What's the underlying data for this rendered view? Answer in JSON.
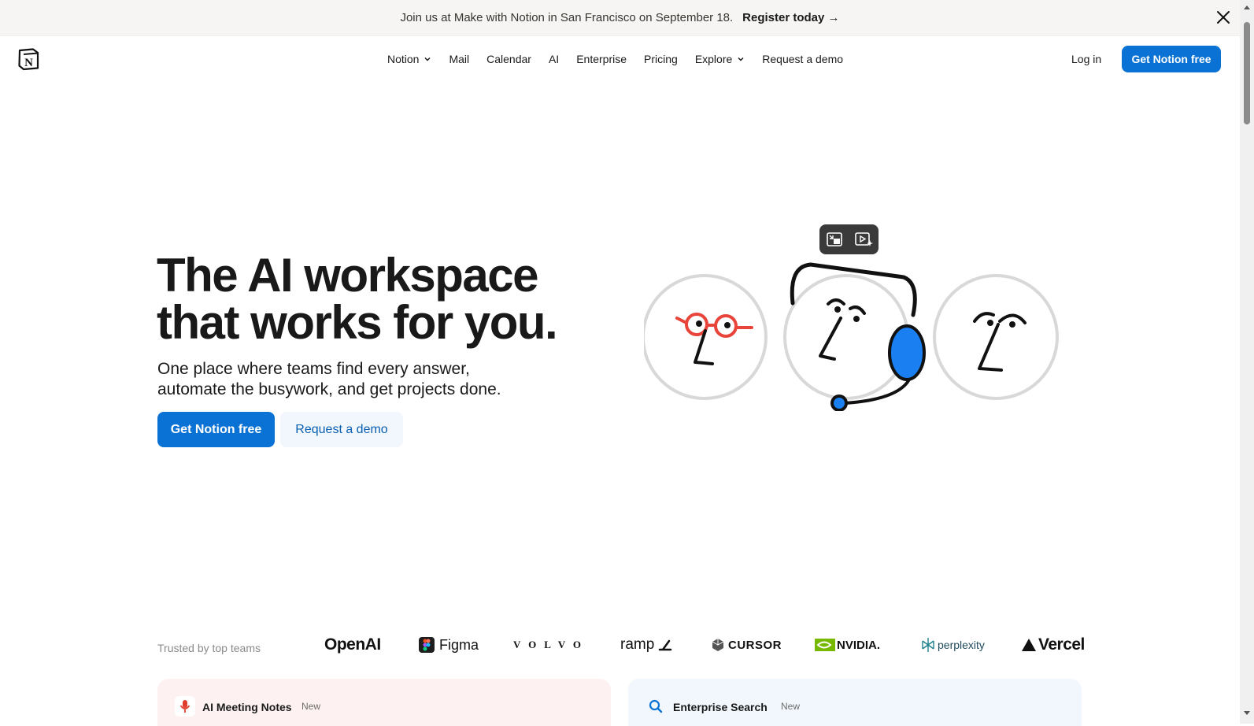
{
  "banner": {
    "message": "Join us at Make with Notion in San Francisco on September 18.",
    "link": "Register today →"
  },
  "nav": {
    "items": [
      {
        "label": "Notion",
        "has_dropdown": true
      },
      {
        "label": "Mail",
        "has_dropdown": false
      },
      {
        "label": "Calendar",
        "has_dropdown": false
      },
      {
        "label": "AI",
        "has_dropdown": false
      },
      {
        "label": "Enterprise",
        "has_dropdown": false
      },
      {
        "label": "Pricing",
        "has_dropdown": false
      },
      {
        "label": "Explore",
        "has_dropdown": true
      },
      {
        "label": "Request a demo",
        "has_dropdown": false
      }
    ],
    "login": "Log in",
    "cta": "Get Notion free"
  },
  "hero": {
    "title_line1": "The AI workspace",
    "title_line2": "that works for you.",
    "subtitle_line1": "One place where teams find every answer,",
    "subtitle_line2": "automate the busywork, and get projects done.",
    "primary_button": "Get Notion free",
    "secondary_button": "Request a demo"
  },
  "trusted": {
    "label": "Trusted by top teams",
    "logos": [
      "OpenAI",
      "Figma",
      "VOLVO",
      "ramp",
      "CURSOR",
      "NVIDIA.",
      "perplexity",
      "Vercel"
    ]
  },
  "cards": [
    {
      "title": "AI Meeting Notes",
      "badge": "New",
      "icon": "microphone-icon"
    },
    {
      "title": "Enterprise Search",
      "badge": "New",
      "icon": "search-icon"
    }
  ],
  "colors": {
    "brand_blue": "#0a72d4",
    "banner_bg": "#f6f5f4",
    "accent_red": "#e8443a",
    "headset_blue": "#1a7ff0"
  }
}
